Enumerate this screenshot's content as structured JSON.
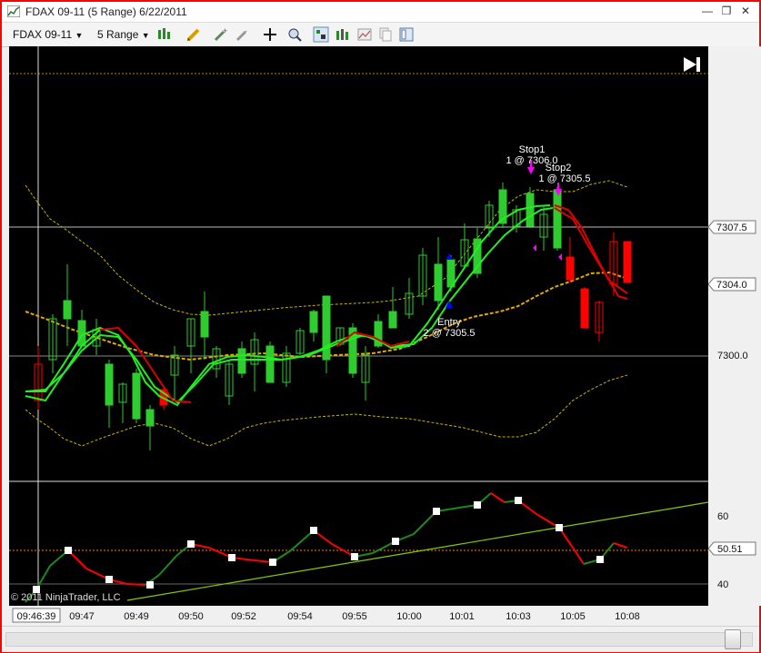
{
  "window": {
    "title": "FDAX 09-11 (5 Range)  6/22/2011",
    "minimize": "—",
    "restore": "❐",
    "close": "✕"
  },
  "toolbar": {
    "instrument": "FDAX 09-11",
    "interval": "5 Range",
    "icons": [
      "chart-style-icon",
      "drawing-pencil-icon",
      "add-indicator-icon",
      "strategy-icon",
      "crosshair-icon",
      "zoom-icon",
      "properties-icon",
      "bar-chart-icon",
      "data-box-icon",
      "copy-icon",
      "template-icon"
    ]
  },
  "price_axis": {
    "ticks": [
      "7300.0"
    ],
    "markers": [
      {
        "label": "7307.5",
        "color": "#ffffff"
      },
      {
        "label": "7304.0",
        "color": "#ffffff"
      }
    ]
  },
  "indicator_axis": {
    "ticks": [
      "60",
      "40"
    ],
    "marker": "50.51",
    "marker_color": "#ffffff"
  },
  "time_axis": {
    "cursor_time": "09:46:39",
    "ticks": [
      "09:47",
      "09:49",
      "09:50",
      "09:52",
      "09:54",
      "09:55",
      "10:00",
      "10:01",
      "10:03",
      "10:05",
      "10:08"
    ]
  },
  "annotations": {
    "stop1_title": "Stop1",
    "stop1_detail": "1 @ 7306.0",
    "stop2_title": "Stop2",
    "stop2_detail": "1 @ 7305.5",
    "entry_title": "Entry",
    "entry_detail": "2 @ 7305.5",
    "copyright": "© 2011 NinjaTrader, LLC"
  },
  "go_to_end_icon": "skip-to-end-icon",
  "colors": {
    "up_candle": "#2ecc2e",
    "down_candle": "#ff0000",
    "fast_ma": "#22ee22",
    "slow_ma": "#dd0000",
    "band": "#c8b400",
    "mid_band": "#e0a800",
    "trendline": "#88cc00"
  }
}
